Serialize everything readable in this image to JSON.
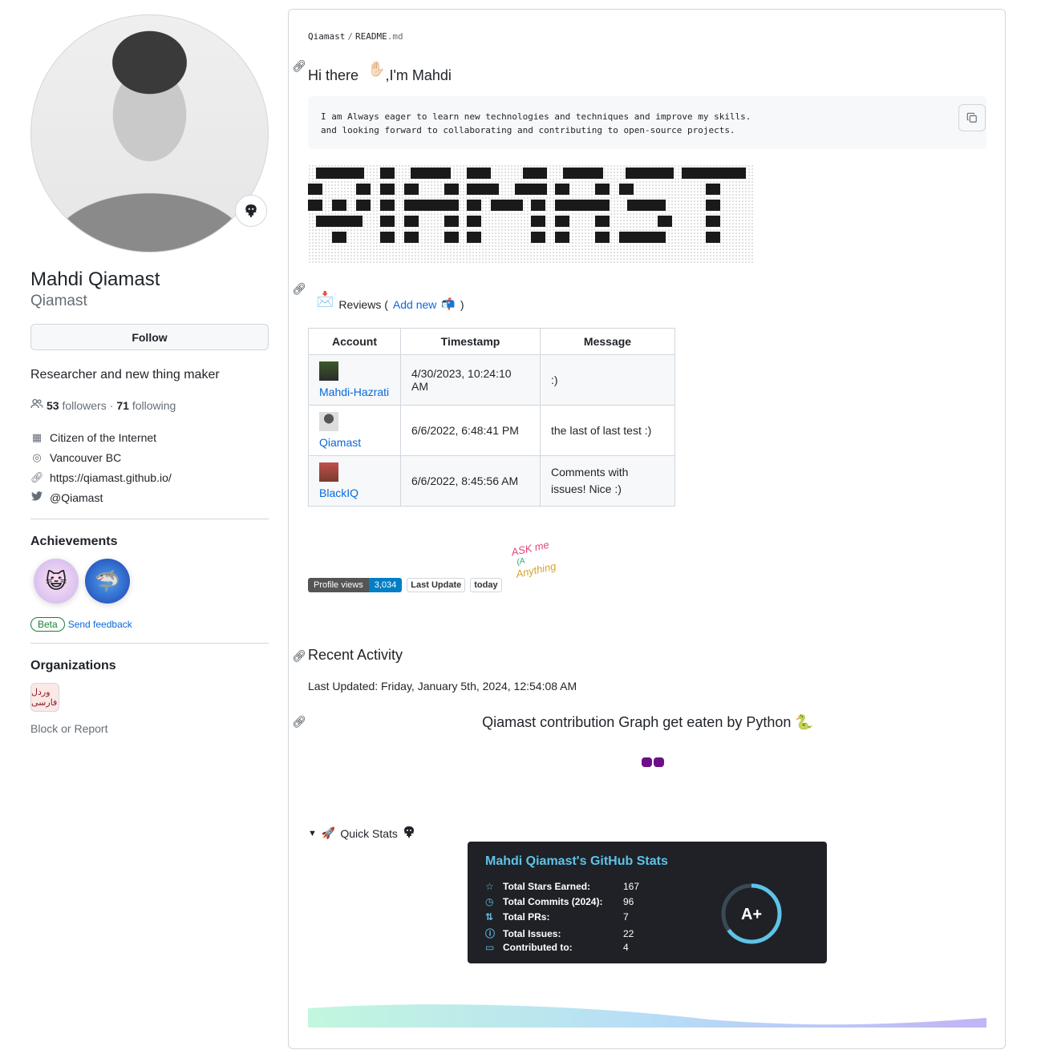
{
  "profile": {
    "name": "Mahdi Qiamast",
    "login": "Qiamast",
    "follow_label": "Follow",
    "bio": "Researcher and new thing maker",
    "followers_count": "53",
    "followers_label": "followers",
    "sep": "·",
    "following_count": "71",
    "following_label": "following",
    "company": "Citizen of the Internet",
    "location": "Vancouver BC",
    "website": "https://qiamast.github.io/",
    "twitter": "@Qiamast"
  },
  "achievements": {
    "heading": "Achievements",
    "badges": [
      "quickdraw-badge",
      "pull-shark-badge"
    ],
    "beta": "Beta",
    "feedback": "Send feedback"
  },
  "organizations": {
    "heading": "Organizations",
    "org_logo_text": "وردل فارسی"
  },
  "block_label": "Block or Report",
  "readme": {
    "crumb_user": "Qiamast",
    "crumb_sep": "/",
    "crumb_file": "README",
    "crumb_ext": ".md",
    "greeting": "Hi there",
    "greeting_emoji": "✋🏻",
    "greeting_tail": ",I'm Mahdi",
    "code_lines": "I am Always eager to learn new technologies and techniques and improve my skills.\nand looking forward to collaborating and contributing to open-source projects.",
    "reviews_label": "Reviews (",
    "reviews_add": "Add new",
    "reviews_close": ")",
    "table": {
      "headers": [
        "Account",
        "Timestamp",
        "Message"
      ],
      "rows": [
        {
          "account": "Mahdi-Hazrati",
          "timestamp": "4/30/2023, 10:24:10 AM",
          "message": ":)"
        },
        {
          "account": "Qiamast",
          "timestamp": "6/6/2022, 6:48:41 PM",
          "message": "the last of last test :)"
        },
        {
          "account": "BlackIQ",
          "timestamp": "6/6/2022, 8:45:56 AM",
          "message": "Comments with issues! Nice :)"
        }
      ]
    },
    "badges": {
      "views_label": "Profile views",
      "views_value": "3,034",
      "last_update": "Last Update",
      "today": "today",
      "colors": {
        "label_bg": "#555555",
        "value_bg": "#007ec6"
      }
    },
    "ask_me": [
      "ASK me",
      "(A",
      "Anything"
    ],
    "recent_heading": "Recent Activity",
    "recent_updated": "Last Updated: Friday, January 5th, 2024, 12:54:08 AM",
    "graph_heading": "Qiamast contribution Graph get eaten by Python",
    "quick_stats": "Quick Stats",
    "stats_card": {
      "title": "Mahdi Qiamast's GitHub Stats",
      "rows": [
        {
          "icon": "star-icon",
          "label": "Total Stars Earned:",
          "value": "167"
        },
        {
          "icon": "clock-icon",
          "label": "Total Commits (2024):",
          "value": "96"
        },
        {
          "icon": "pr-icon",
          "label": "Total PRs:",
          "value": "7"
        },
        {
          "icon": "issue-icon",
          "label": "Total Issues:",
          "value": "22"
        },
        {
          "icon": "repo-icon",
          "label": "Contributed to:",
          "value": "4"
        }
      ],
      "grade": "A+",
      "grade_fraction": 0.65,
      "colors": {
        "bg": "#1f2126",
        "accent": "#5ec3e8"
      }
    }
  }
}
